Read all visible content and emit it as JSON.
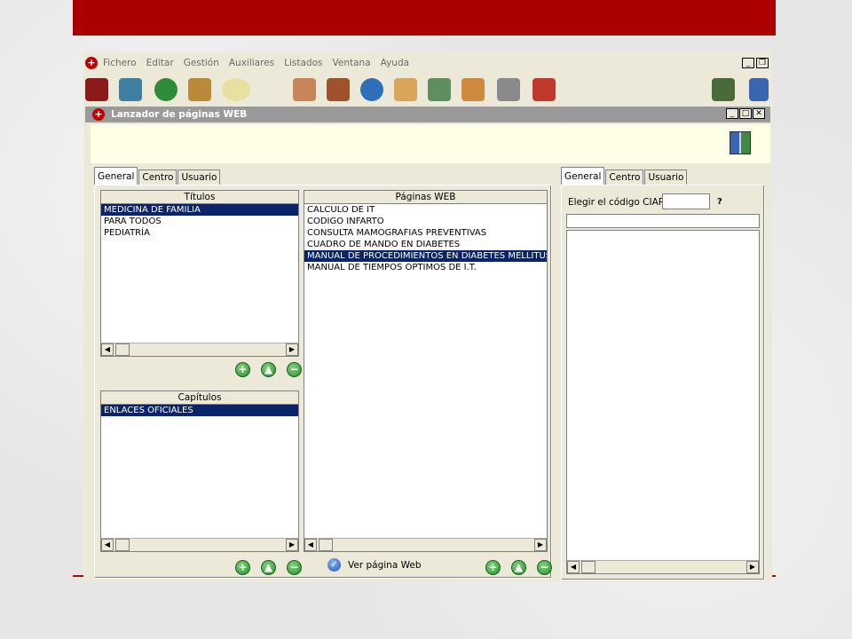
{
  "menubar": {
    "items": [
      "Fichero",
      "Editar",
      "Gestión",
      "Auxiliares",
      "Listados",
      "Ventana",
      "Ayuda"
    ]
  },
  "toolbar": {
    "icons": [
      "chart-icon",
      "envelope-icon",
      "info-icon",
      "syringe-icon",
      "pill-icon",
      "thumbs-down-icon",
      "toolbox-icon",
      "globe-icon",
      "house-icon",
      "family-icon",
      "group-icon",
      "speaker-icon",
      "folder-icon",
      "clipboard-icon",
      "exit-door-icon"
    ]
  },
  "child_window": {
    "title": "Lanzador de páginas WEB"
  },
  "left_panel": {
    "tabs": [
      "General",
      "Centro",
      "Usuario"
    ],
    "titulos": {
      "header": "Títulos",
      "items": [
        "MEDICINA DE FAMILIA",
        "PARA TODOS",
        "PEDIATRÍA"
      ]
    },
    "capitulos": {
      "header": "Capítulos",
      "items": [
        "ENLACES OFICIALES"
      ]
    },
    "paginas": {
      "header": "Páginas WEB",
      "items": [
        "CALCULO DE IT",
        "CODIGO INFARTO",
        "CONSULTA MAMOGRAFIAS PREVENTIVAS",
        "CUADRO DE MANDO EN DIABETES",
        "MANUAL DE PROCEDIMIENTOS EN DIABETES MELLITUS",
        "MANUAL DE TIEMPOS OPTIMOS DE I.T."
      ]
    },
    "ver_pagina": "Ver página Web"
  },
  "right_panel": {
    "tabs": [
      "General",
      "Centro",
      "Usuario"
    ],
    "ciap_label": "Elegir el código CIAP",
    "ciap_value": "",
    "help": "?"
  },
  "colors": {
    "brand_red": "#aa0000",
    "selection": "#0a246a",
    "window_bg": "#ece9d8"
  }
}
